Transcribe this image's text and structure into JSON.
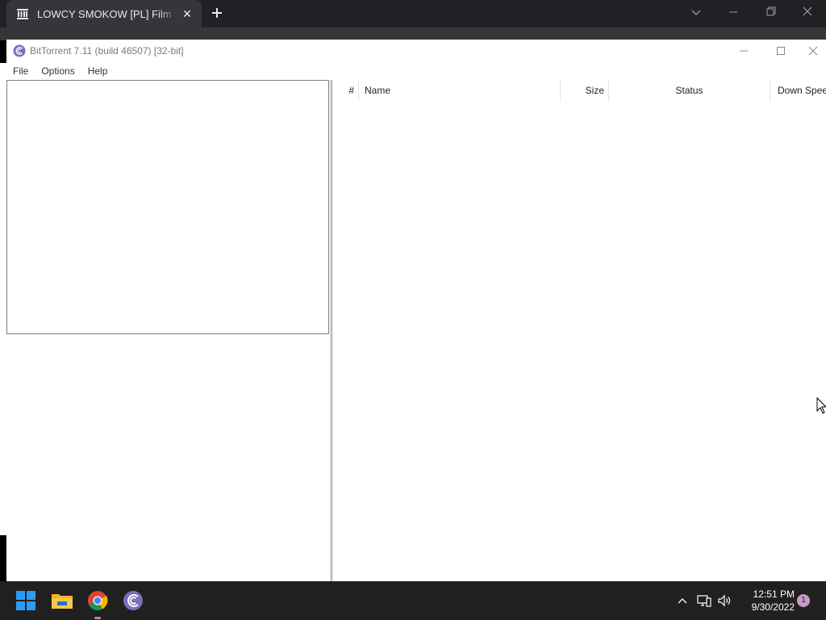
{
  "browser": {
    "tab_title": "LOWCY SMOKOW [PL] Film : HAO",
    "tab_close": "✕",
    "new_tab": "+"
  },
  "bittorrent": {
    "window_title": "BitTorrent 7.11  (build 46507) [32-bit]",
    "menu": [
      "File",
      "Options",
      "Help"
    ],
    "columns": {
      "num": "#",
      "name": "Name",
      "size": "Size",
      "status": "Status",
      "down_speed": "Down Speed"
    }
  },
  "taskbar": {
    "time": "12:51 PM",
    "date": "9/30/2022",
    "notification_count": "1"
  },
  "colors": {
    "taskbar_bg": "#202020",
    "browser_bg": "#202124",
    "windows_blue": "#2b9bf4",
    "bittorrent_accent": "#7b6fb8"
  }
}
